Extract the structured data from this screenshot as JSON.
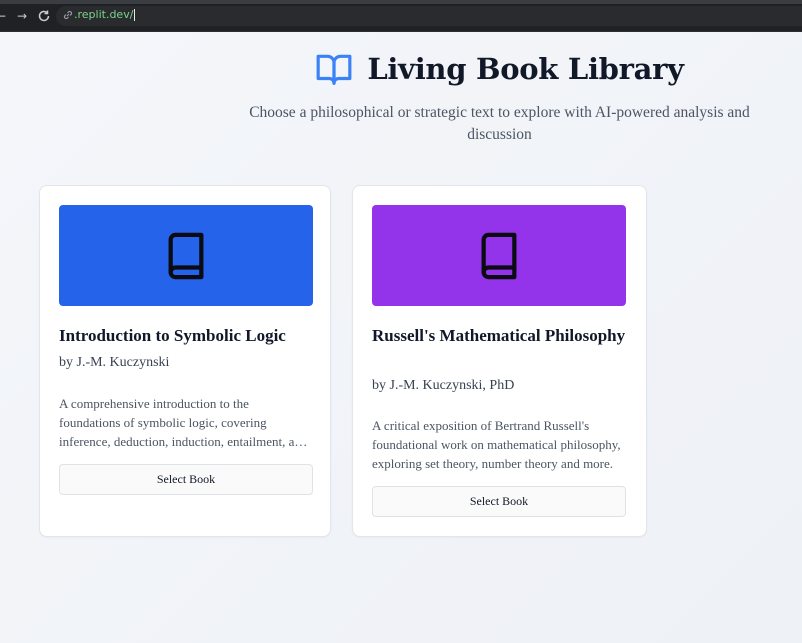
{
  "browser": {
    "url": ".replit.dev/"
  },
  "header": {
    "title": "Living Book Library",
    "subtitle": "Choose a philosophical or strategic text to explore with AI-powered analysis and discussion",
    "icon": "open-book-icon",
    "icon_color": "#3b82f6"
  },
  "books": [
    {
      "title": "Introduction to Symbolic Logic",
      "author": "by J.-M. Kuczynski",
      "description": "A comprehensive introduction to the foundations of symbolic logic, covering inference, deduction, induction, entailment, and more.",
      "cover_color": "#2563eb",
      "button_label": "Select Book"
    },
    {
      "title": "Russell's Mathematical Philosophy",
      "author": "by J.-M. Kuczynski, PhD",
      "description": "A critical exposition of Bertrand Russell's foundational work on mathematical philosophy, exploring set theory, number theory and more.",
      "cover_color": "#9333ea",
      "button_label": "Select Book"
    }
  ]
}
